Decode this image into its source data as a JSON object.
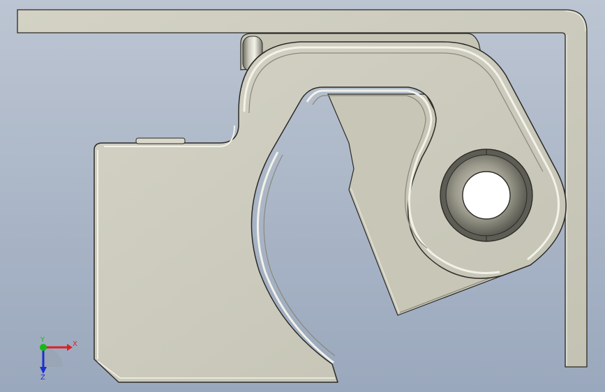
{
  "viewport": {
    "background_top": "#bcc5d2",
    "background_bottom": "#9aa8bd"
  },
  "colors": {
    "part_fill": "#cac9bb",
    "part_fill_dark": "#b5b3a3",
    "edge": "#2b2a25",
    "highlight": "#f3f2e8",
    "shadow": "#8a887a",
    "bore": "#5e5d55"
  },
  "triad": {
    "x_label": "X",
    "y_label": "Y",
    "z_label": "Z",
    "x_color": "#e02020",
    "y_color": "#18b818",
    "z_color": "#1c2fd0"
  }
}
